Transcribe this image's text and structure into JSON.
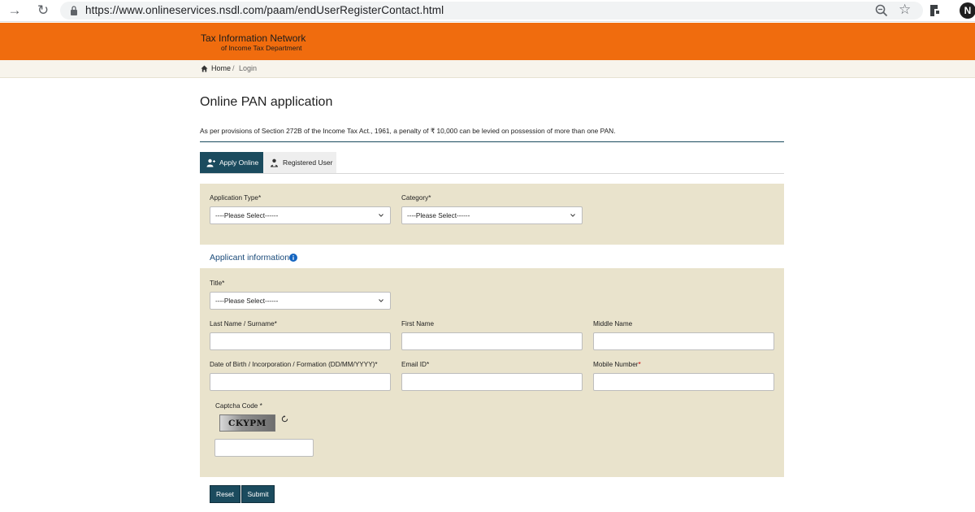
{
  "browser": {
    "url": "https://www.onlineservices.nsdl.com/paam/endUserRegisterContact.html",
    "profile_initial": "N"
  },
  "header": {
    "logo_line1": "Tax Information Network",
    "logo_line2": "of Income Tax Department",
    "bg_color": "#f06c0e"
  },
  "breadcrumb": {
    "home": "Home",
    "separator": "/",
    "current": "Login"
  },
  "page": {
    "title": "Online PAN application",
    "penalty_note": "As per provisions of Section 272B of the Income Tax Act., 1961, a penalty of ₹ 10,000 can be levied on possession of more than one PAN."
  },
  "tabs": {
    "apply_online": "Apply Online",
    "registered_user": "Registered User"
  },
  "form": {
    "application_type_label": "Application Type",
    "application_type_value": "----Please Select------",
    "category_label": "Category",
    "category_value": "----Please Select------",
    "section_title": "Applicant information",
    "title_label": "Title",
    "title_value": "----Please Select------",
    "last_name_label": "Last Name / Surname",
    "first_name_label": "First Name",
    "middle_name_label": "Middle Name",
    "dob_label": "Date of Birth / Incorporation / Formation (DD/MM/YYYY)",
    "email_label": "Email ID",
    "mobile_label": "Mobile Number",
    "captcha_label": "Captcha Code",
    "captcha_text": "CKYPM",
    "required_mark": "*"
  },
  "buttons": {
    "reset": "Reset",
    "submit": "Submit"
  },
  "colors": {
    "primary": "#1b4b5e",
    "panel_bg": "#e9e3cc",
    "link_blue": "#1b4b7a"
  }
}
